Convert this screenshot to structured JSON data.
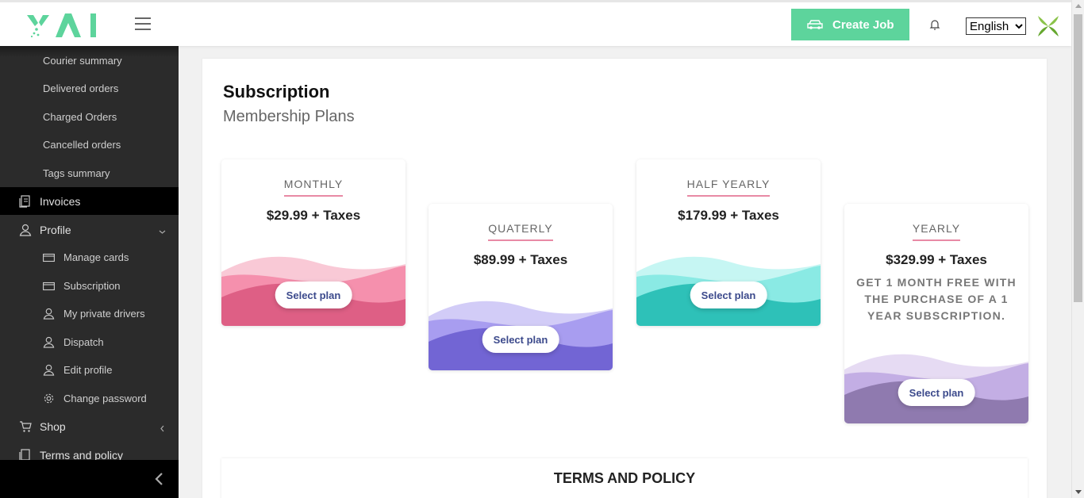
{
  "header": {
    "create_job_label": "Create Job",
    "language": "English",
    "language_options": [
      "English"
    ]
  },
  "sidebar": {
    "items": [
      {
        "label": "Courier summary"
      },
      {
        "label": "Delivered orders"
      },
      {
        "label": "Charged Orders"
      },
      {
        "label": "Cancelled orders"
      },
      {
        "label": "Tags summary"
      },
      {
        "label": "Invoices"
      },
      {
        "label": "Profile"
      },
      {
        "label": "Manage cards"
      },
      {
        "label": "Subscription"
      },
      {
        "label": "My private drivers"
      },
      {
        "label": "Dispatch"
      },
      {
        "label": "Edit profile"
      },
      {
        "label": "Change password"
      },
      {
        "label": "Shop"
      },
      {
        "label": "Terms and policy"
      }
    ]
  },
  "main": {
    "title": "Subscription",
    "subtitle": "Membership Plans",
    "plans": [
      {
        "name": "MONTHLY",
        "price": "$29.99 + Taxes",
        "button": "Select plan",
        "colors": [
          "#f9c9d6",
          "#f590ad",
          "#d9577e"
        ]
      },
      {
        "name": "QUATERLY",
        "price": "$89.99 + Taxes",
        "button": "Select plan",
        "colors": [
          "#d2ccf7",
          "#a89df0",
          "#6b5fd0"
        ]
      },
      {
        "name": "HALF YEARLY",
        "price": "$179.99 + Taxes",
        "button": "Select plan",
        "colors": [
          "#c6f6f3",
          "#8aeae4",
          "#23bdb3"
        ]
      },
      {
        "name": "YEARLY",
        "price": "$329.99 + Taxes",
        "note": "GET 1 MONTH FREE WITH THE PURCHASE OF A 1 YEAR SUBSCRIPTION.",
        "button": "Select plan",
        "colors": [
          "#e6dbf3",
          "#c3aee4",
          "#8a74a8"
        ]
      }
    ],
    "terms_title": "TERMS AND POLICY"
  },
  "colors": {
    "accent_green": "#5dd49c",
    "sidebar_bg": "#2b2b2b",
    "button_text": "#3c4a8c",
    "underline_pink": "#e88aa5"
  }
}
